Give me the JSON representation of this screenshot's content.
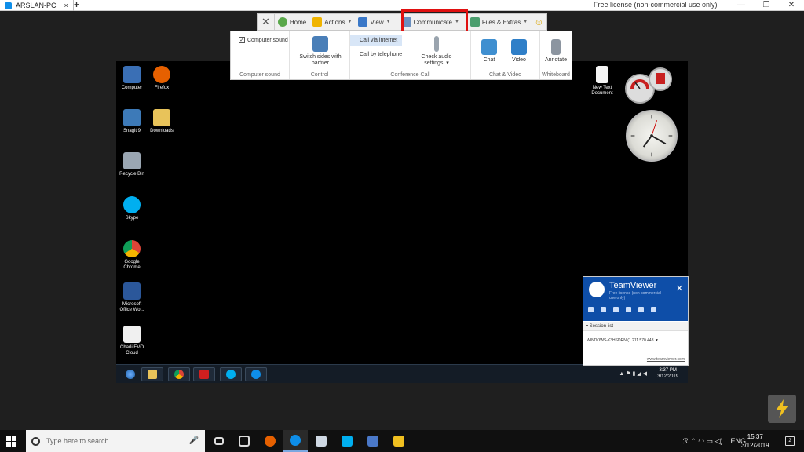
{
  "window": {
    "tab_title": "ARSLAN-PC",
    "tab_close": "×",
    "new_tab": "+",
    "license_text": "Free license (non-commercial use only)",
    "minimize": "—",
    "restore": "❐",
    "close": "✕"
  },
  "toolbar": {
    "close_label": "✕",
    "home_label": "Home",
    "actions_label": "Actions",
    "view_label": "View",
    "communicate_label": "Communicate",
    "files_label": "Files & Extras",
    "emoji": "☺",
    "highlight_color": "#e01010"
  },
  "ribbon": {
    "computer_sound_label": "Computer sound",
    "computer_sound_checked": true,
    "group_computer_sound": "Computer sound",
    "switch_sides_label": "Switch sides with partner",
    "group_control": "Control",
    "call_via_internet": "Call via internet",
    "call_by_telephone": "Call by telephone",
    "check_audio": "Check audio settings! ▾",
    "group_conference": "Conference Call",
    "chat_label": "Chat",
    "video_label": "Video",
    "group_chat_video": "Chat & Video",
    "annotate_label": "Annotate",
    "group_whiteboard": "Whiteboard"
  },
  "remote_desktop": {
    "icons": [
      {
        "label": "Computer",
        "color": "#3a6fb5"
      },
      {
        "label": "Firefox",
        "color": "#e66000"
      },
      {
        "label": "Snagit 9",
        "color": "#3d7ab8"
      },
      {
        "label": "Downloads",
        "color": "#e8c35a"
      },
      {
        "label": "Recycle Bin",
        "color": "#9aa6b2"
      },
      {
        "label": "Skype",
        "color": "#00aff0"
      },
      {
        "label": "Google Chrome",
        "color": "#db4437"
      },
      {
        "label": "Microsoft Office Wo...",
        "color": "#2b579a"
      },
      {
        "label": "Charli EVO Cloud",
        "color": "#f0f0f0"
      },
      {
        "label": "New Text Document",
        "color": "#f5f5f5"
      }
    ],
    "taskbar_time": "3:37 PM",
    "taskbar_date": "3/12/2019",
    "tray_icons": "▲ ⚑ ▮ ◢ ◀"
  },
  "teamviewer_panel": {
    "title": "TeamViewer",
    "subtitle": "Free license (non-commercial use only)",
    "close": "✕",
    "session_list": "▾ Session list",
    "session_row": "WINDOWS-K3HSDRN (1 211 570 443 ▼",
    "link": "www.teamviewer.com",
    "accent": "#0e4ea8"
  },
  "windows_taskbar": {
    "search_placeholder": "Type here to search",
    "mic": "🎤",
    "tray": "ℛ  ⌃  ◠  ▭  ◁)",
    "lang": "ENG",
    "time": "15:37",
    "date": "3/12/2019",
    "notif_count": "2"
  }
}
